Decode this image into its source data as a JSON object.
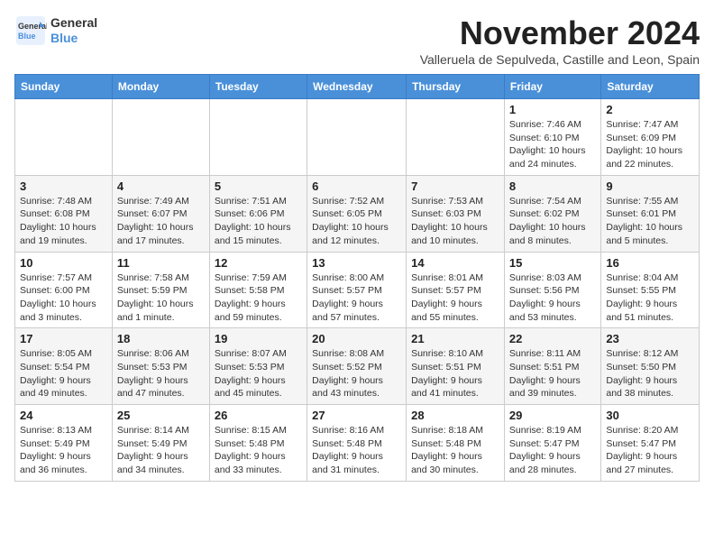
{
  "logo": {
    "line1": "General",
    "line2": "Blue"
  },
  "header": {
    "month_year": "November 2024",
    "subtitle": "Valleruela de Sepulveda, Castille and Leon, Spain"
  },
  "weekdays": [
    "Sunday",
    "Monday",
    "Tuesday",
    "Wednesday",
    "Thursday",
    "Friday",
    "Saturday"
  ],
  "weeks": [
    [
      {
        "day": "",
        "info": ""
      },
      {
        "day": "",
        "info": ""
      },
      {
        "day": "",
        "info": ""
      },
      {
        "day": "",
        "info": ""
      },
      {
        "day": "",
        "info": ""
      },
      {
        "day": "1",
        "info": "Sunrise: 7:46 AM\nSunset: 6:10 PM\nDaylight: 10 hours and 24 minutes."
      },
      {
        "day": "2",
        "info": "Sunrise: 7:47 AM\nSunset: 6:09 PM\nDaylight: 10 hours and 22 minutes."
      }
    ],
    [
      {
        "day": "3",
        "info": "Sunrise: 7:48 AM\nSunset: 6:08 PM\nDaylight: 10 hours and 19 minutes."
      },
      {
        "day": "4",
        "info": "Sunrise: 7:49 AM\nSunset: 6:07 PM\nDaylight: 10 hours and 17 minutes."
      },
      {
        "day": "5",
        "info": "Sunrise: 7:51 AM\nSunset: 6:06 PM\nDaylight: 10 hours and 15 minutes."
      },
      {
        "day": "6",
        "info": "Sunrise: 7:52 AM\nSunset: 6:05 PM\nDaylight: 10 hours and 12 minutes."
      },
      {
        "day": "7",
        "info": "Sunrise: 7:53 AM\nSunset: 6:03 PM\nDaylight: 10 hours and 10 minutes."
      },
      {
        "day": "8",
        "info": "Sunrise: 7:54 AM\nSunset: 6:02 PM\nDaylight: 10 hours and 8 minutes."
      },
      {
        "day": "9",
        "info": "Sunrise: 7:55 AM\nSunset: 6:01 PM\nDaylight: 10 hours and 5 minutes."
      }
    ],
    [
      {
        "day": "10",
        "info": "Sunrise: 7:57 AM\nSunset: 6:00 PM\nDaylight: 10 hours and 3 minutes."
      },
      {
        "day": "11",
        "info": "Sunrise: 7:58 AM\nSunset: 5:59 PM\nDaylight: 10 hours and 1 minute."
      },
      {
        "day": "12",
        "info": "Sunrise: 7:59 AM\nSunset: 5:58 PM\nDaylight: 9 hours and 59 minutes."
      },
      {
        "day": "13",
        "info": "Sunrise: 8:00 AM\nSunset: 5:57 PM\nDaylight: 9 hours and 57 minutes."
      },
      {
        "day": "14",
        "info": "Sunrise: 8:01 AM\nSunset: 5:57 PM\nDaylight: 9 hours and 55 minutes."
      },
      {
        "day": "15",
        "info": "Sunrise: 8:03 AM\nSunset: 5:56 PM\nDaylight: 9 hours and 53 minutes."
      },
      {
        "day": "16",
        "info": "Sunrise: 8:04 AM\nSunset: 5:55 PM\nDaylight: 9 hours and 51 minutes."
      }
    ],
    [
      {
        "day": "17",
        "info": "Sunrise: 8:05 AM\nSunset: 5:54 PM\nDaylight: 9 hours and 49 minutes."
      },
      {
        "day": "18",
        "info": "Sunrise: 8:06 AM\nSunset: 5:53 PM\nDaylight: 9 hours and 47 minutes."
      },
      {
        "day": "19",
        "info": "Sunrise: 8:07 AM\nSunset: 5:53 PM\nDaylight: 9 hours and 45 minutes."
      },
      {
        "day": "20",
        "info": "Sunrise: 8:08 AM\nSunset: 5:52 PM\nDaylight: 9 hours and 43 minutes."
      },
      {
        "day": "21",
        "info": "Sunrise: 8:10 AM\nSunset: 5:51 PM\nDaylight: 9 hours and 41 minutes."
      },
      {
        "day": "22",
        "info": "Sunrise: 8:11 AM\nSunset: 5:51 PM\nDaylight: 9 hours and 39 minutes."
      },
      {
        "day": "23",
        "info": "Sunrise: 8:12 AM\nSunset: 5:50 PM\nDaylight: 9 hours and 38 minutes."
      }
    ],
    [
      {
        "day": "24",
        "info": "Sunrise: 8:13 AM\nSunset: 5:49 PM\nDaylight: 9 hours and 36 minutes."
      },
      {
        "day": "25",
        "info": "Sunrise: 8:14 AM\nSunset: 5:49 PM\nDaylight: 9 hours and 34 minutes."
      },
      {
        "day": "26",
        "info": "Sunrise: 8:15 AM\nSunset: 5:48 PM\nDaylight: 9 hours and 33 minutes."
      },
      {
        "day": "27",
        "info": "Sunrise: 8:16 AM\nSunset: 5:48 PM\nDaylight: 9 hours and 31 minutes."
      },
      {
        "day": "28",
        "info": "Sunrise: 8:18 AM\nSunset: 5:48 PM\nDaylight: 9 hours and 30 minutes."
      },
      {
        "day": "29",
        "info": "Sunrise: 8:19 AM\nSunset: 5:47 PM\nDaylight: 9 hours and 28 minutes."
      },
      {
        "day": "30",
        "info": "Sunrise: 8:20 AM\nSunset: 5:47 PM\nDaylight: 9 hours and 27 minutes."
      }
    ]
  ]
}
